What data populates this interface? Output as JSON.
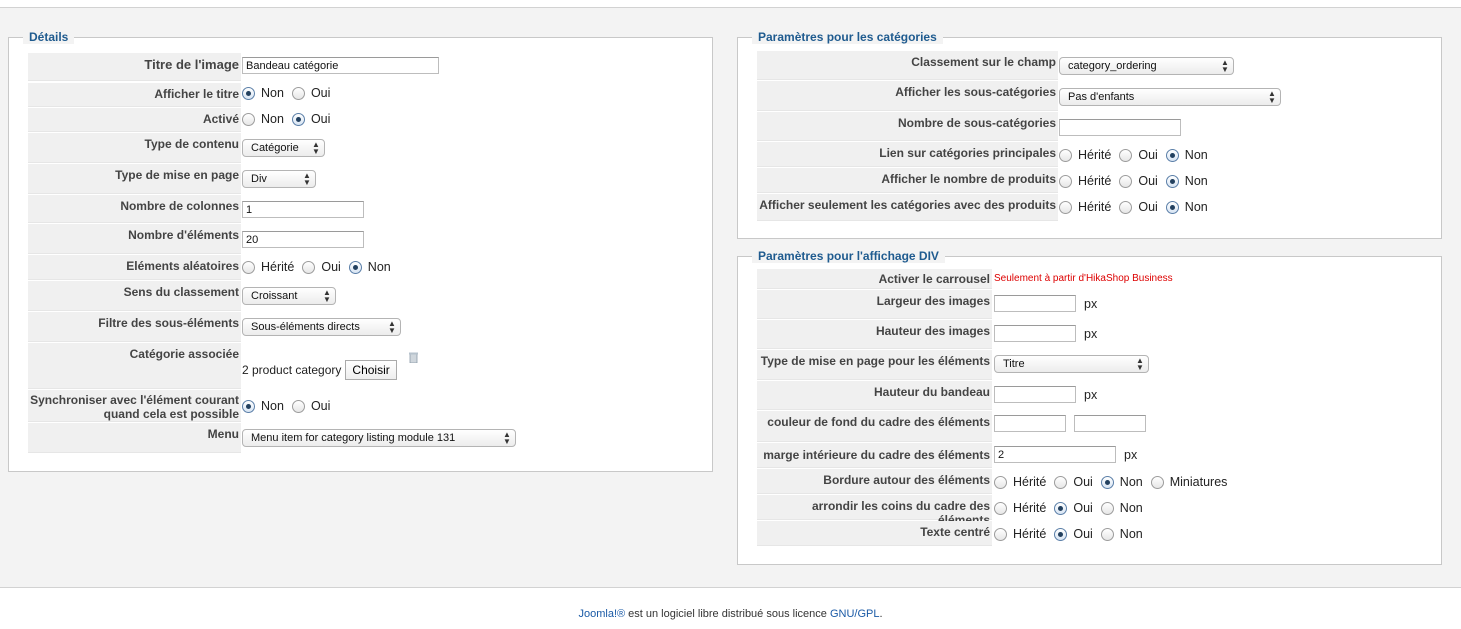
{
  "details": {
    "legend": "Détails",
    "titre_label": "Titre de l'image",
    "titre_value": "Bandeau catégorie",
    "afficher_titre_label": "Afficher le titre",
    "afficher_titre_opts": [
      "Non",
      "Oui"
    ],
    "active_label": "Activé",
    "active_opts": [
      "Non",
      "Oui"
    ],
    "type_contenu_label": "Type de contenu",
    "type_contenu_value": "Catégorie",
    "type_mise_label": "Type de mise en page",
    "type_mise_value": "Div",
    "nb_colonnes_label": "Nombre de colonnes",
    "nb_colonnes_value": "1",
    "nb_elements_label": "Nombre d'éléments",
    "nb_elements_value": "20",
    "aleatoires_label": "Eléments aléatoires",
    "aleatoires_opts": [
      "Hérité",
      "Oui",
      "Non"
    ],
    "sens_label": "Sens du classement",
    "sens_value": "Croissant",
    "filtre_label": "Filtre des sous-éléments",
    "filtre_value": "Sous-éléments directs",
    "categorie_label": "Catégorie associée",
    "categorie_value": "2 product category",
    "choisir_button": "Choisir",
    "sync_label_1": "Synchroniser avec l'élément courant",
    "sync_label_2": "quand cela est possible",
    "sync_opts": [
      "Non",
      "Oui"
    ],
    "menu_label": "Menu",
    "menu_value": "Menu item for category listing module 131"
  },
  "categories": {
    "legend": "Paramètres pour les catégories",
    "classement_label": "Classement sur le champ",
    "classement_value": "category_ordering",
    "sous_cat_label": "Afficher les sous-catégories",
    "sous_cat_value": "Pas d'enfants",
    "nb_sous_cat_label": "Nombre de sous-catégories",
    "nb_sous_cat_value": "",
    "lien_label": "Lien sur catégories principales",
    "nb_produits_label": "Afficher le nombre de produits",
    "seulement_label": "Afficher seulement les catégories avec des produits",
    "opts3": [
      "Hérité",
      "Oui",
      "Non"
    ]
  },
  "div": {
    "legend": "Paramètres pour l'affichage DIV",
    "carrousel_label": "Activer le carrousel",
    "carrousel_note": "Seulement à partir d'HikaShop Business",
    "largeur_label": "Largeur des images",
    "hauteur_label": "Hauteur des images",
    "type_mise_label": "Type de mise en page pour les éléments",
    "type_mise_value": "Titre",
    "hauteur_bandeau_label": "Hauteur du bandeau",
    "couleur_label": "couleur de fond du cadre des éléments",
    "marge_label": "marge intérieure du cadre des éléments",
    "marge_value": "2",
    "bordure_label": "Bordure autour des éléments",
    "bordure_opts": [
      "Hérité",
      "Oui",
      "Non",
      "Miniatures"
    ],
    "arrondir_label": "arrondir les coins du cadre des éléments",
    "centre_label": "Texte centré",
    "opts3": [
      "Hérité",
      "Oui",
      "Non"
    ],
    "unit": "px"
  },
  "footer": {
    "brand": "Joomla!®",
    "text": " est un logiciel libre distribué sous licence ",
    "license": "GNU/GPL",
    "end": "."
  }
}
